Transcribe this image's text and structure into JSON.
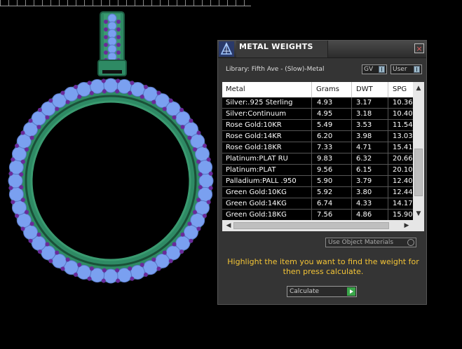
{
  "panel": {
    "title": "METAL WEIGHTS",
    "close_glyph": "×",
    "library_label": "Library: Fifth Ave - (Slow)-Metal",
    "dropdown_gv": "GV",
    "dropdown_user": "User",
    "columns": [
      "Metal",
      "Grams",
      "DWT",
      "SPG"
    ],
    "rows": [
      {
        "metal": "Silver:.925 Sterling",
        "grams": "4.93",
        "dwt": "3.17",
        "spg": "10.36"
      },
      {
        "metal": "Silver:Continuum",
        "grams": "4.95",
        "dwt": "3.18",
        "spg": "10.40"
      },
      {
        "metal": "Rose Gold:10KR",
        "grams": "5.49",
        "dwt": "3.53",
        "spg": "11.54"
      },
      {
        "metal": "Rose Gold:14KR",
        "grams": "6.20",
        "dwt": "3.98",
        "spg": "13.03"
      },
      {
        "metal": "Rose Gold:18KR",
        "grams": "7.33",
        "dwt": "4.71",
        "spg": "15.41"
      },
      {
        "metal": "Platinum:PLAT RU",
        "grams": "9.83",
        "dwt": "6.32",
        "spg": "20.66"
      },
      {
        "metal": "Platinum:PLAT",
        "grams": "9.56",
        "dwt": "6.15",
        "spg": "20.10"
      },
      {
        "metal": "Palladium:PALL .950",
        "grams": "5.90",
        "dwt": "3.79",
        "spg": "12.40"
      },
      {
        "metal": "Green Gold:10KG",
        "grams": "5.92",
        "dwt": "3.80",
        "spg": "12.44"
      },
      {
        "metal": "Green Gold:14KG",
        "grams": "6.74",
        "dwt": "4.33",
        "spg": "14.17"
      },
      {
        "metal": "Green Gold:18KG",
        "grams": "7.56",
        "dwt": "4.86",
        "spg": "15.90"
      }
    ],
    "use_object_materials": "Use Object Materials",
    "hint_text": "Highlight the item you want to find the weight for then press calculate.",
    "calculate_label": "Calculate"
  },
  "colors": {
    "hint": "#f3c436",
    "calc_go": "#3aa64a",
    "gem": "#7aa0f0",
    "prong": "#6a2a9a",
    "metal": "#2e8a64"
  },
  "icons": [
    "app-logo-icon",
    "close-icon",
    "dropdown-arrow-icon",
    "checkbox-icon",
    "play-arrow-icon",
    "scroll-up-icon",
    "scroll-down-icon",
    "scroll-left-icon",
    "scroll-right-icon"
  ]
}
